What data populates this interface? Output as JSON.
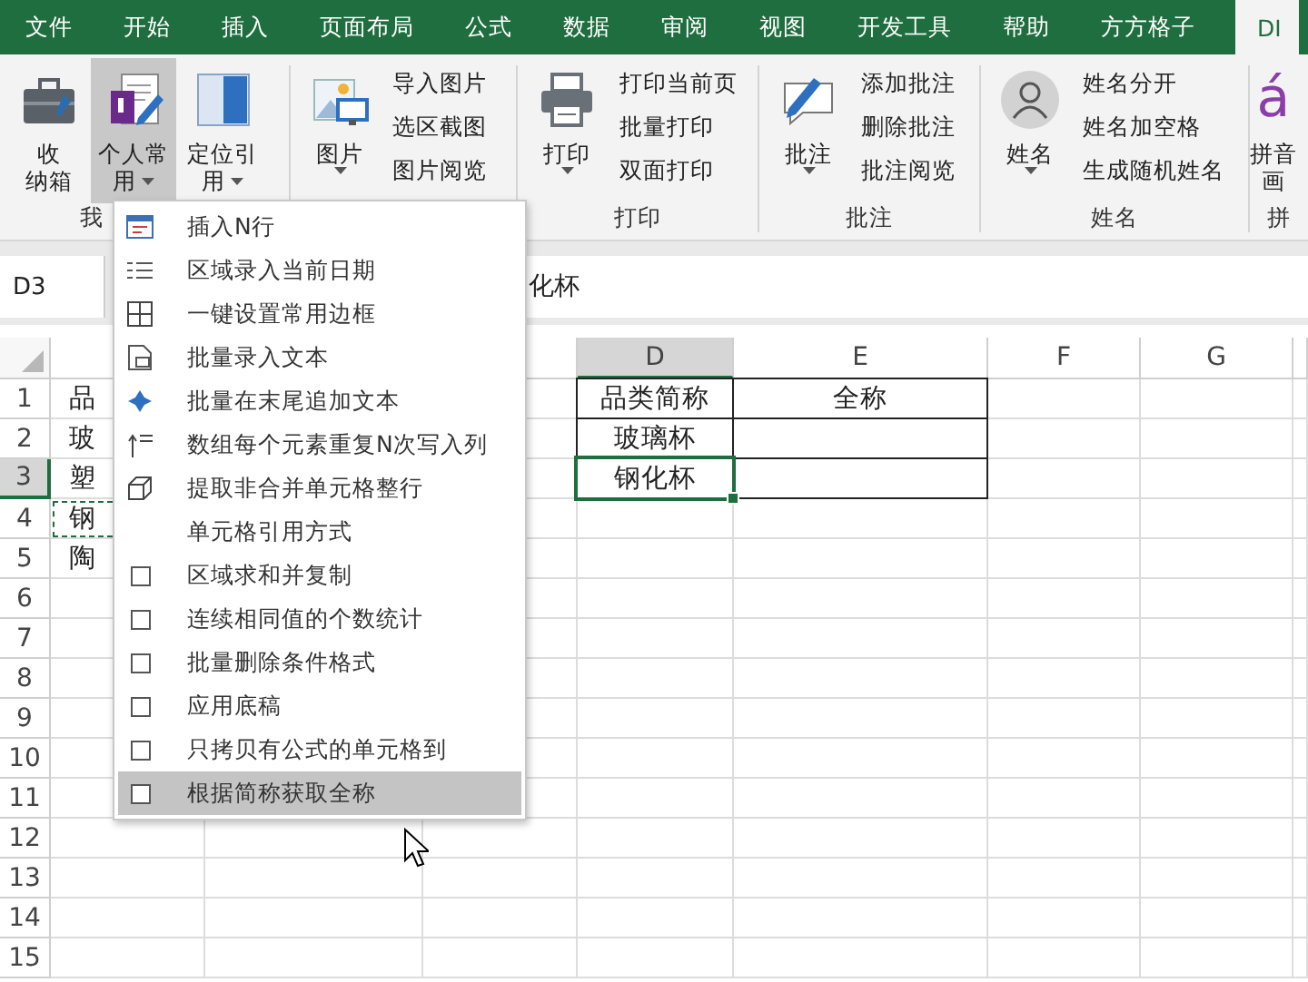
{
  "tabs": [
    {
      "label": "文件",
      "selected": false
    },
    {
      "label": "开始",
      "selected": false
    },
    {
      "label": "插入",
      "selected": false
    },
    {
      "label": "页面布局",
      "selected": false
    },
    {
      "label": "公式",
      "selected": false
    },
    {
      "label": "数据",
      "selected": false
    },
    {
      "label": "审阅",
      "selected": false
    },
    {
      "label": "视图",
      "selected": false
    },
    {
      "label": "开发工具",
      "selected": false
    },
    {
      "label": "帮助",
      "selected": false
    },
    {
      "label": "方方格子",
      "selected": false
    },
    {
      "label": "DI",
      "selected": true
    }
  ],
  "ribbon": [
    {
      "label": "我",
      "big": [
        {
          "lines": [
            "收",
            "纳箱"
          ],
          "dropdown": false,
          "pressed": false
        },
        {
          "lines": [
            "个人常",
            "用"
          ],
          "dropdown": true,
          "pressed": true
        },
        {
          "lines": [
            "定位引",
            "用"
          ],
          "dropdown": true,
          "pressed": false
        }
      ]
    },
    {
      "big": [
        {
          "lines": [
            "图片"
          ],
          "dropdown": true,
          "pressed": false
        }
      ],
      "small": [
        "导入图片",
        "选区截图",
        "图片阅览"
      ]
    },
    {
      "label": "打印",
      "big": [
        {
          "lines": [
            "打印"
          ],
          "dropdown": true,
          "pressed": false
        }
      ],
      "small": [
        "打印当前页",
        "批量打印",
        "双面打印"
      ]
    },
    {
      "label": "批注",
      "big": [
        {
          "lines": [
            "批注"
          ],
          "dropdown": true,
          "pressed": false
        }
      ],
      "small": [
        "添加批注",
        "删除批注",
        "批注阅览"
      ]
    },
    {
      "label": "姓名",
      "big": [
        {
          "lines": [
            "姓名"
          ],
          "dropdown": true,
          "pressed": false
        }
      ],
      "small": [
        "姓名分开",
        "姓名加空格",
        "生成随机姓名"
      ]
    },
    {
      "label": "拼",
      "big": [
        {
          "lines": [
            "拼音",
            "画"
          ],
          "dropdown": false,
          "pressed": false,
          "icon_text": "á"
        }
      ]
    }
  ],
  "formula_bar": {
    "name_box": "D3",
    "value": "化杯"
  },
  "sheet": {
    "columns": [
      {
        "label": "D",
        "selected": true
      },
      {
        "label": "E",
        "selected": false
      },
      {
        "label": "F",
        "selected": false
      },
      {
        "label": "G",
        "selected": false
      }
    ],
    "rows": [
      {
        "number": "1",
        "selected": false,
        "marquee": false,
        "bordered": true,
        "col_a": "品",
        "col_d": "品类简称",
        "col_e": "全称"
      },
      {
        "number": "2",
        "selected": false,
        "marquee": false,
        "bordered": true,
        "col_a": "玻",
        "col_d": "玻璃杯"
      },
      {
        "number": "3",
        "selected": true,
        "marquee": false,
        "bordered": true,
        "col_a": "塑",
        "col_d": "钢化杯"
      },
      {
        "number": "4",
        "selected": false,
        "marquee": true,
        "bordered": false,
        "col_a": "钢"
      },
      {
        "number": "5",
        "selected": false,
        "marquee": false,
        "bordered": false,
        "col_a": "陶"
      },
      {
        "number": "6",
        "selected": false,
        "marquee": false,
        "bordered": false
      },
      {
        "number": "7",
        "selected": false,
        "marquee": false,
        "bordered": false
      },
      {
        "number": "8",
        "selected": false,
        "marquee": false,
        "bordered": false
      },
      {
        "number": "9",
        "selected": false,
        "marquee": false,
        "bordered": false
      },
      {
        "number": "10",
        "selected": false,
        "marquee": false,
        "bordered": false
      },
      {
        "number": "11",
        "selected": false,
        "marquee": false,
        "bordered": false
      },
      {
        "number": "12",
        "selected": false,
        "marquee": false,
        "bordered": false
      },
      {
        "number": "13",
        "selected": false,
        "marquee": false,
        "bordered": false
      },
      {
        "number": "14",
        "selected": false,
        "marquee": false,
        "bordered": false
      },
      {
        "number": "15",
        "selected": false,
        "marquee": false,
        "bordered": false
      }
    ]
  },
  "menu": [
    {
      "label": "插入N行",
      "kind": "icon",
      "selected": false
    },
    {
      "label": "区域录入当前日期",
      "kind": "icon",
      "selected": false
    },
    {
      "label": "一键设置常用边框",
      "kind": "icon",
      "selected": false
    },
    {
      "label": "批量录入文本",
      "kind": "icon",
      "selected": false
    },
    {
      "label": "批量在末尾追加文本",
      "kind": "icon",
      "selected": false
    },
    {
      "label": "数组每个元素重复N次写入列",
      "kind": "icon",
      "selected": false
    },
    {
      "label": "提取非合并单元格整行",
      "kind": "icon",
      "selected": false
    },
    {
      "label": "单元格引用方式",
      "kind": "plain",
      "selected": false
    },
    {
      "label": "区域求和并复制",
      "kind": "square",
      "selected": false
    },
    {
      "label": "连续相同值的个数统计",
      "kind": "square",
      "selected": false
    },
    {
      "label": "批量删除条件格式",
      "kind": "square",
      "selected": false
    },
    {
      "label": "应用底稿",
      "kind": "square",
      "selected": false
    },
    {
      "label": "只拷贝有公式的单元格到",
      "kind": "square",
      "selected": false
    },
    {
      "label": "根据简称获取全称",
      "kind": "square",
      "selected": true
    }
  ]
}
